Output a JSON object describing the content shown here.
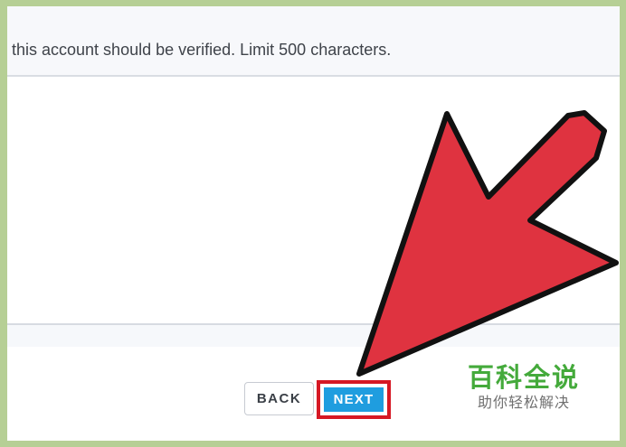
{
  "instruction": {
    "text": "this account should be verified. Limit 500 characters."
  },
  "buttons": {
    "back": "BACK",
    "next": "NEXT"
  },
  "annotation": {
    "arrow_color": "#df3340",
    "highlight_color": "#d61824"
  },
  "watermark": {
    "title": "百科全说",
    "subtitle": "助你轻松解决"
  },
  "colors": {
    "background": "#b6cf95",
    "next_button": "#1f9ddf",
    "watermark": "#44aa3b"
  }
}
